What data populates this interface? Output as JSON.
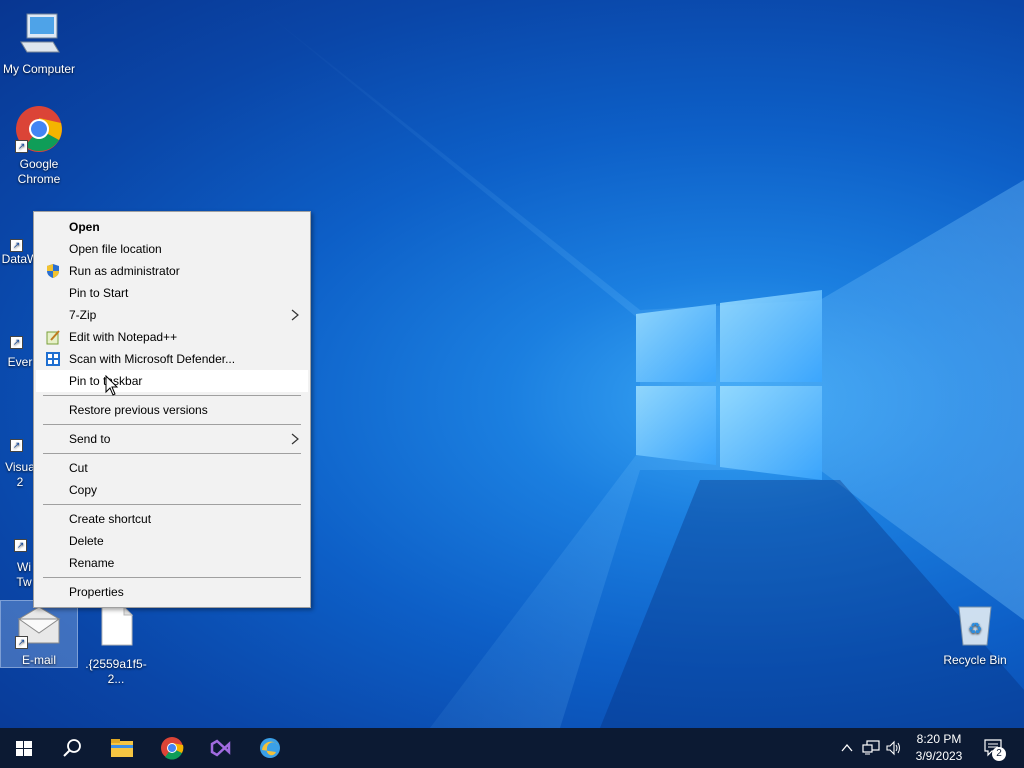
{
  "desktop": {
    "icons": [
      {
        "label": "My Computer"
      },
      {
        "label_line1": "Google",
        "label_line2": "Chrome"
      },
      {
        "label": "DataW"
      },
      {
        "label": "Ever"
      },
      {
        "label_line1": "Visua",
        "label_line2": "2"
      },
      {
        "label_line1": "Wi",
        "label_line2": "Tw"
      },
      {
        "label": "E-mail"
      },
      {
        "label": ".{2559a1f5-2..."
      },
      {
        "label": "Recycle Bin"
      }
    ]
  },
  "context_menu": {
    "items": [
      {
        "label": "Open"
      },
      {
        "label": "Open file location"
      },
      {
        "label": "Run as administrator"
      },
      {
        "label": "Pin to Start"
      },
      {
        "label": "7-Zip"
      },
      {
        "label": "Edit with Notepad++"
      },
      {
        "label": "Scan with Microsoft Defender..."
      },
      {
        "label": "Pin to taskbar"
      },
      {
        "label": "Restore previous versions"
      },
      {
        "label": "Send to"
      },
      {
        "label": "Cut"
      },
      {
        "label": "Copy"
      },
      {
        "label": "Create shortcut"
      },
      {
        "label": "Delete"
      },
      {
        "label": "Rename"
      },
      {
        "label": "Properties"
      }
    ]
  },
  "taskbar": {
    "apps": [
      "start-icon",
      "search-icon",
      "file-explorer-icon",
      "chrome-icon",
      "visual-studio-icon",
      "edge-icon"
    ],
    "clock": {
      "time": "8:20 PM",
      "date": "3/9/2023"
    },
    "notification_count": "2"
  },
  "colors": {
    "taskbar": "#0c1a33",
    "menu_bg": "#f2f2f2",
    "desktop_accent": "#1b7fe0"
  }
}
